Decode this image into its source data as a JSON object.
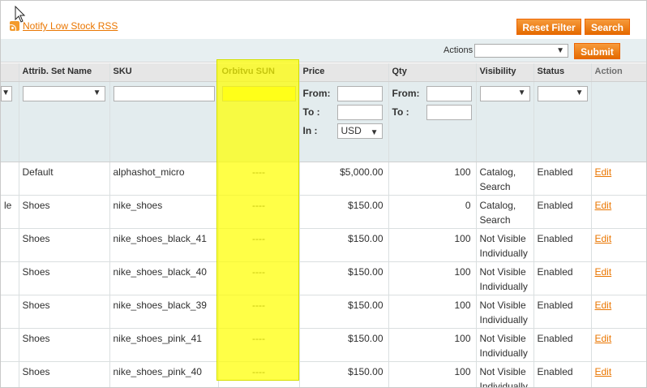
{
  "rss": {
    "label": "Notify Low Stock RSS"
  },
  "buttons": {
    "reset_filter": "Reset Filter",
    "search": "Search",
    "submit": "Submit"
  },
  "massactions": {
    "label": "Actions",
    "selected": ""
  },
  "columns": {
    "type_partial": "",
    "attrib_set": "Attrib. Set Name",
    "sku": "SKU",
    "orbitvu": "Orbitvu SUN",
    "price": "Price",
    "qty": "Qty",
    "visibility": "Visibility",
    "status": "Status",
    "action": "Action"
  },
  "filters": {
    "from": "From:",
    "to": "To :",
    "in": "In :",
    "currency": "USD"
  },
  "rows": [
    {
      "type_partial": "",
      "attrib_set": "Default",
      "sku": "alphashot_micro",
      "orbitvu": "----",
      "price": "$5,000.00",
      "qty": "100",
      "visibility_line1": "Catalog,",
      "visibility_line2": "Search",
      "status": "Enabled",
      "action": "Edit"
    },
    {
      "type_partial": "le",
      "attrib_set": "Shoes",
      "sku": "nike_shoes",
      "orbitvu": "----",
      "price": "$150.00",
      "qty": "0",
      "visibility_line1": "Catalog,",
      "visibility_line2": "Search",
      "status": "Enabled",
      "action": "Edit"
    },
    {
      "type_partial": "",
      "attrib_set": "Shoes",
      "sku": "nike_shoes_black_41",
      "orbitvu": "----",
      "price": "$150.00",
      "qty": "100",
      "visibility_line1": "Not Visible",
      "visibility_line2": "Individually",
      "status": "Enabled",
      "action": "Edit"
    },
    {
      "type_partial": "",
      "attrib_set": "Shoes",
      "sku": "nike_shoes_black_40",
      "orbitvu": "----",
      "price": "$150.00",
      "qty": "100",
      "visibility_line1": "Not Visible",
      "visibility_line2": "Individually",
      "status": "Enabled",
      "action": "Edit"
    },
    {
      "type_partial": "",
      "attrib_set": "Shoes",
      "sku": "nike_shoes_black_39",
      "orbitvu": "----",
      "price": "$150.00",
      "qty": "100",
      "visibility_line1": "Not Visible",
      "visibility_line2": "Individually",
      "status": "Enabled",
      "action": "Edit"
    },
    {
      "type_partial": "",
      "attrib_set": "Shoes",
      "sku": "nike_shoes_pink_41",
      "orbitvu": "----",
      "price": "$150.00",
      "qty": "100",
      "visibility_line1": "Not Visible",
      "visibility_line2": "Individually",
      "status": "Enabled",
      "action": "Edit"
    },
    {
      "type_partial": "",
      "attrib_set": "Shoes",
      "sku": "nike_shoes_pink_40",
      "orbitvu": "----",
      "price": "$150.00",
      "qty": "100",
      "visibility_line1": "Not Visible",
      "visibility_line2": "Individually",
      "status": "Enabled",
      "action": "Edit"
    }
  ],
  "colors": {
    "accent": "#ea7601",
    "button": "#eb6b05",
    "highlight": "#ffff00",
    "header_bg": "#e6e6e6",
    "filter_bg": "#e3ecee"
  },
  "icons": {
    "rss": "rss-icon",
    "cursor": "mouse-pointer-icon",
    "dropdown": "chevron-down-icon"
  }
}
